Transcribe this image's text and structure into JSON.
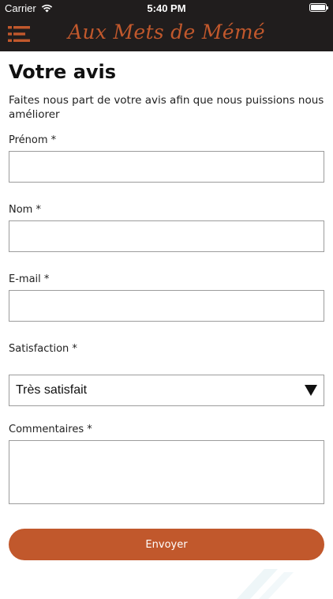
{
  "status_bar": {
    "carrier": "Carrier",
    "time": "5:40 PM",
    "battery_level": 1.0
  },
  "header": {
    "brand": "Aux Mets de Mémé",
    "menu_icon": "menu-icon",
    "background": "#201d1d",
    "accent": "#c1582c"
  },
  "page": {
    "title": "Votre avis",
    "intro": "Faites nous part de votre avis afin que nous puissions nous améliorer"
  },
  "form": {
    "first_name": {
      "label": "Prénom *",
      "value": ""
    },
    "last_name": {
      "label": "Nom *",
      "value": ""
    },
    "email": {
      "label": "E-mail *",
      "value": ""
    },
    "satisfaction": {
      "label": "Satisfaction *",
      "selected": "Très satisfait"
    },
    "comments": {
      "label": "Commentaires *",
      "value": ""
    },
    "submit_label": "Envoyer"
  }
}
